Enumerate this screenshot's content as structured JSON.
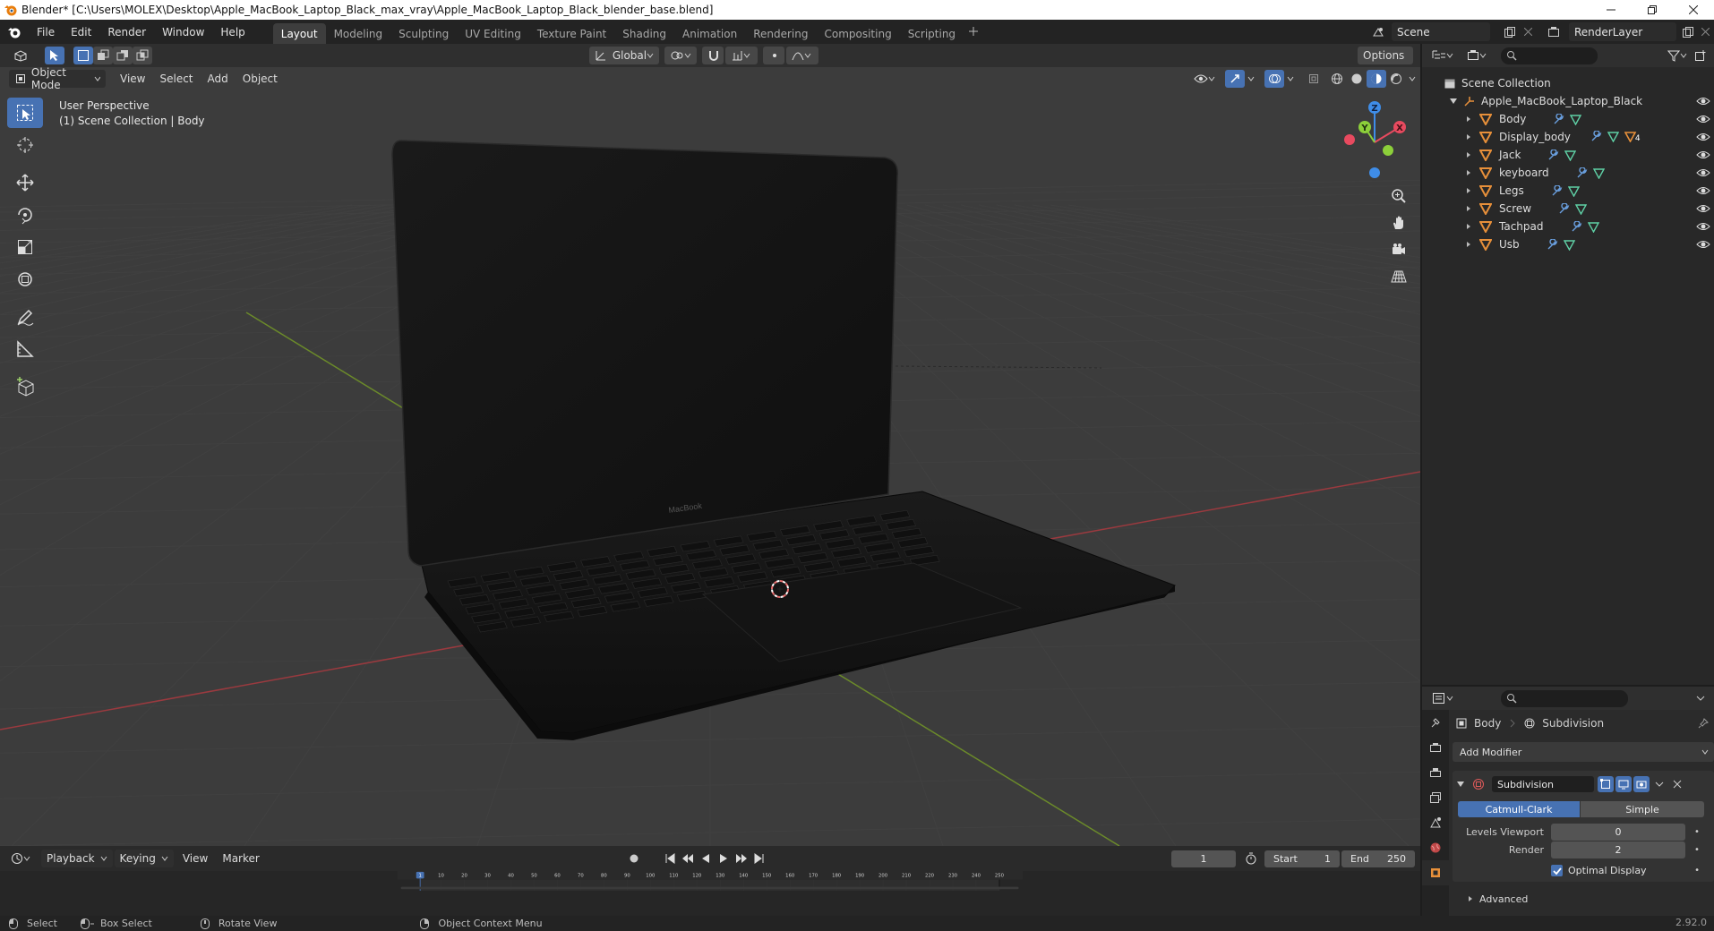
{
  "window": {
    "title": "Blender* [C:\\Users\\MOLEX\\Desktop\\Apple_MacBook_Laptop_Black_max_vray\\Apple_MacBook_Laptop_Black_blender_base.blend]"
  },
  "menu": {
    "items": [
      "File",
      "Edit",
      "Render",
      "Window",
      "Help"
    ]
  },
  "workspaces": {
    "tabs": [
      "Layout",
      "Modeling",
      "Sculpting",
      "UV Editing",
      "Texture Paint",
      "Shading",
      "Animation",
      "Rendering",
      "Compositing",
      "Scripting"
    ],
    "active": "Layout"
  },
  "scene": {
    "name": "Scene",
    "render_layer": "RenderLayer"
  },
  "viewport": {
    "transform_orientation": "Global",
    "options_label": "Options",
    "mode": "Object Mode",
    "header_menus": [
      "View",
      "Select",
      "Add",
      "Object"
    ],
    "info_line1": "User Perspective",
    "info_line2": "(1) Scene Collection | Body",
    "gizmo_axes": {
      "z": "Z",
      "y": "Y",
      "x": "X"
    },
    "laptop_brand": "MacBook"
  },
  "outliner": {
    "root": "Scene Collection",
    "collection": "Apple_MacBook_Laptop_Black",
    "objects": [
      "Body",
      "Display_body",
      "Jack",
      "keyboard",
      "Legs",
      "Screw",
      "Tachpad",
      "Usb"
    ],
    "display_body_badge": "4"
  },
  "properties": {
    "object_name": "Body",
    "modifier_crumb": "Subdivision",
    "add_modifier": "Add Modifier",
    "modifier_name": "Subdivision",
    "algo_options": [
      "Catmull-Clark",
      "Simple"
    ],
    "algo_active": "Catmull-Clark",
    "levels_viewport_label": "Levels Viewport",
    "levels_viewport_value": "0",
    "render_label": "Render",
    "render_value": "2",
    "optimal_display_label": "Optimal Display",
    "optimal_display_checked": true,
    "advanced_label": "Advanced"
  },
  "timeline": {
    "menus": [
      "Playback",
      "Keying",
      "View",
      "Marker"
    ],
    "current_frame": "1",
    "start_label": "Start",
    "start_value": "1",
    "end_label": "End",
    "end_value": "250",
    "ruler_ticks": [
      "1",
      "10",
      "20",
      "30",
      "40",
      "50",
      "60",
      "70",
      "80",
      "90",
      "100",
      "110",
      "120",
      "130",
      "140",
      "150",
      "160",
      "170",
      "180",
      "190",
      "200",
      "210",
      "220",
      "230",
      "240",
      "250"
    ]
  },
  "status": {
    "select": "Select",
    "box_select": "Box Select",
    "rotate_view": "Rotate View",
    "context_menu": "Object Context Menu",
    "version": "2.92.0"
  },
  "colors": {
    "accent": "#4772b3",
    "object_icon": "#e8903a",
    "modifier_icon": "#6aa0e0",
    "mesh_icon": "#5fd1a6",
    "axis_x": "#e84a5f",
    "axis_y": "#8ccf3a",
    "axis_z": "#3f8de8"
  }
}
